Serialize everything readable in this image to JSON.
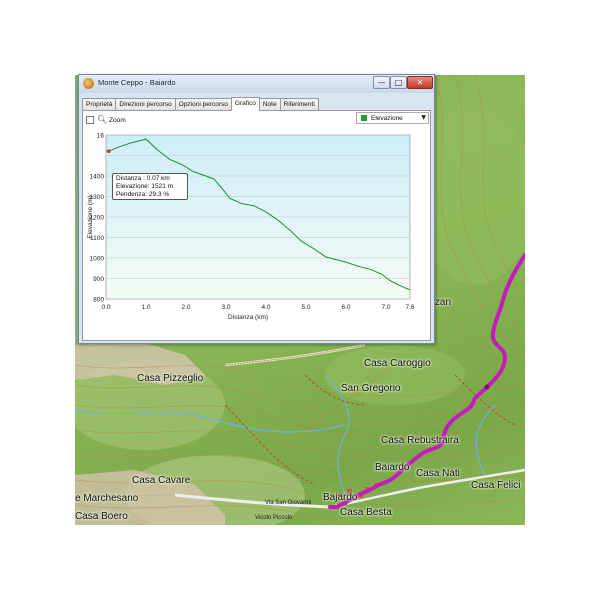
{
  "window": {
    "title": "Monte Ceppo - Baiardo",
    "min_glyph": "—",
    "max_glyph": "□",
    "close_glyph": "✕"
  },
  "tabs": [
    {
      "label": "Proprietà",
      "active": false
    },
    {
      "label": "Direzioni percorso",
      "active": false
    },
    {
      "label": "Opzioni percorso",
      "active": false
    },
    {
      "label": "Grafico",
      "active": true
    },
    {
      "label": "Note",
      "active": false
    },
    {
      "label": "Riferimenti",
      "active": false
    }
  ],
  "toolbar": {
    "zoom_label": "Zoom",
    "zoom_checked": false
  },
  "series_select": {
    "value": "Elevazione",
    "color": "#1a9e3a"
  },
  "tooltip": {
    "line1": "Distanza : 0.07 km",
    "line2": "Elevazione: 1521 m",
    "line3": "Pendenza: 29.3 %"
  },
  "chart_data": {
    "type": "area",
    "xlabel": "Distanza  (km)",
    "ylabel": "Elevazione (m)",
    "ylim": [
      800,
      1600
    ],
    "xlim": [
      0,
      7.6
    ],
    "x_ticks": [
      "0.0",
      "1.0",
      "2.0",
      "3.0",
      "4.0",
      "5.0",
      "6.0",
      "7.0",
      "7.6"
    ],
    "x_tick_values": [
      0,
      1,
      2,
      3,
      4,
      5,
      6,
      7,
      7.6
    ],
    "y_ticks": [
      800,
      900,
      1000,
      1100,
      1200,
      1300,
      1400,
      1500,
      1600
    ],
    "y_tick_labels": [
      "800",
      "900",
      "1000",
      "1100",
      "1200",
      "1300",
      "1400",
      "",
      "16"
    ],
    "grid": true,
    "line_color": "#1f8a2c",
    "series": [
      {
        "x": [
          0,
          0.07,
          0.3,
          0.6,
          1.0,
          1.3,
          1.6,
          1.9,
          2.2,
          2.5,
          2.7,
          2.9,
          3.1,
          3.4,
          3.7,
          4.0,
          4.3,
          4.6,
          4.9,
          5.2,
          5.5,
          5.8,
          6.0,
          6.3,
          6.6,
          6.9,
          7.1,
          7.3,
          7.5,
          7.6
        ],
        "y": [
          1520,
          1521,
          1540,
          1560,
          1580,
          1525,
          1480,
          1455,
          1420,
          1400,
          1385,
          1340,
          1290,
          1265,
          1255,
          1225,
          1185,
          1135,
          1080,
          1045,
          1005,
          990,
          980,
          960,
          945,
          920,
          890,
          870,
          852,
          845
        ]
      }
    ]
  },
  "map": {
    "places": [
      {
        "text": "Mezzan",
        "id": "mezzan"
      },
      {
        "text": "Casa Caroggio",
        "id": "casa-caroggio"
      },
      {
        "text": "Casa Pizzeglio",
        "id": "casa-pizzeglio"
      },
      {
        "text": "San Gregorio",
        "id": "san-gregorio"
      },
      {
        "text": "Casa Rebustraira",
        "id": "casa-rebustraira"
      },
      {
        "text": "Baiardo",
        "id": "baiardo"
      },
      {
        "text": "Casa Nati",
        "id": "casa-nati"
      },
      {
        "text": "Casa Cavare",
        "id": "casa-cavare"
      },
      {
        "text": "Casa Felici",
        "id": "casa-felici"
      },
      {
        "text": "e Marchesano",
        "id": "marchesano"
      },
      {
        "text": "Bajardo",
        "id": "bajardo"
      },
      {
        "text": "Casa Boero",
        "id": "casa-boero"
      },
      {
        "text": "Casa Besta",
        "id": "casa-besta"
      }
    ],
    "road_labels": [
      {
        "text": "Via San Giovanni",
        "id": "via-san-giovanni"
      },
      {
        "text": "Vicolo Piccolo",
        "id": "vicolo-piccolo"
      }
    ],
    "route_color": "#c51bbd"
  }
}
